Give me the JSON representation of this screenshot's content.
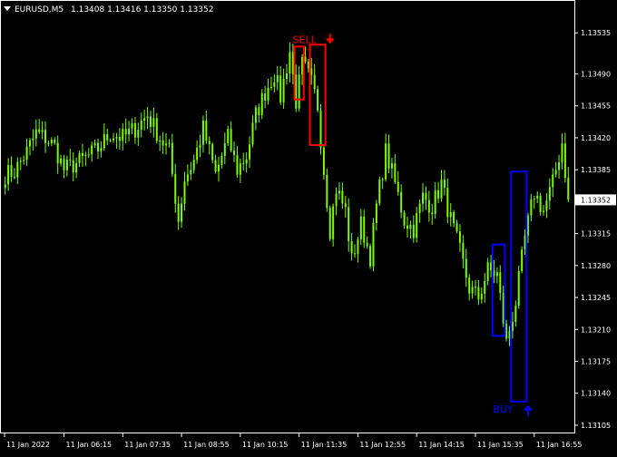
{
  "header": {
    "symbol": "EURUSD,M5",
    "ohlc": "1.13408 1.13416 1.13350 1.13352"
  },
  "colors": {
    "background": "#000000",
    "candle": "#7CFC00",
    "axis": "#ffffff",
    "sell": "#ff0000",
    "buy": "#0000ff",
    "price_tag_bg": "#ffffff",
    "price_tag_text": "#000000"
  },
  "signals": {
    "sell_label": "SELL",
    "buy_label": "BUY"
  },
  "chart_data": {
    "type": "candlestick",
    "title": "EURUSD,M5",
    "y_ticks": [
      "1.13535",
      "1.13490",
      "1.13455",
      "1.13420",
      "1.13385",
      "1.13350",
      "1.13315",
      "1.13280",
      "1.13245",
      "1.13210",
      "1.13175",
      "1.13140",
      "1.13105"
    ],
    "x_ticks": [
      "11 Jan 2022",
      "11 Jan 06:15",
      "11 Jan 07:35",
      "11 Jan 08:55",
      "11 Jan 10:15",
      "11 Jan 11:35",
      "11 Jan 12:55",
      "11 Jan 14:15",
      "11 Jan 15:35",
      "11 Jan 16:55"
    ],
    "ylim": [
      1.13097,
      1.1357
    ],
    "current_price": "1.13352",
    "close_path": [
      [
        0,
        1.1338
      ],
      [
        3,
        1.13383
      ],
      [
        7,
        1.13405
      ],
      [
        10,
        1.13425
      ],
      [
        13,
        1.1342
      ],
      [
        16,
        1.1341
      ],
      [
        19,
        1.13385
      ],
      [
        23,
        1.13392
      ],
      [
        27,
        1.134
      ],
      [
        30,
        1.13408
      ],
      [
        34,
        1.13425
      ],
      [
        38,
        1.1342
      ],
      [
        42,
        1.1343
      ],
      [
        46,
        1.13445
      ],
      [
        50,
        1.1342
      ],
      [
        53,
        1.13405
      ],
      [
        56,
        1.1333
      ],
      [
        58,
        1.13375
      ],
      [
        61,
        1.13395
      ],
      [
        64,
        1.1343
      ],
      [
        68,
        1.1338
      ],
      [
        72,
        1.1342
      ],
      [
        75,
        1.13385
      ],
      [
        78,
        1.134
      ],
      [
        81,
        1.13445
      ],
      [
        84,
        1.1347
      ],
      [
        87,
        1.1349
      ],
      [
        89,
        1.13465
      ],
      [
        92,
        1.13515
      ],
      [
        94,
        1.1346
      ],
      [
        96,
        1.135
      ],
      [
        97,
        1.13495
      ],
      [
        99,
        1.1348
      ],
      [
        101,
        1.13455
      ],
      [
        103,
        1.13385
      ],
      [
        105,
        1.1332
      ],
      [
        107,
        1.13365
      ],
      [
        110,
        1.1334
      ],
      [
        112,
        1.13285
      ],
      [
        115,
        1.13325
      ],
      [
        118,
        1.1329
      ],
      [
        120,
        1.13345
      ],
      [
        123,
        1.13405
      ],
      [
        126,
        1.1337
      ],
      [
        129,
        1.1333
      ],
      [
        132,
        1.1332
      ],
      [
        135,
        1.13355
      ],
      [
        138,
        1.13345
      ],
      [
        141,
        1.1337
      ],
      [
        144,
        1.1333
      ],
      [
        147,
        1.13295
      ],
      [
        150,
        1.13255
      ],
      [
        153,
        1.13245
      ],
      [
        156,
        1.13275
      ],
      [
        159,
        1.1327
      ],
      [
        162,
        1.13195
      ],
      [
        165,
        1.1324
      ],
      [
        168,
        1.1331
      ],
      [
        171,
        1.1336
      ],
      [
        174,
        1.1334
      ],
      [
        177,
        1.1337
      ],
      [
        180,
        1.13415
      ],
      [
        182,
        1.13352
      ]
    ],
    "last_index": 182,
    "signals": [
      {
        "type": "sell",
        "label": "SELL",
        "box_start": 94,
        "box_end": 96,
        "box_high": 1.1352,
        "box_low": 1.13462,
        "arrow_index": 105
      },
      {
        "type": "sell",
        "label": "",
        "box_start": 99,
        "box_end": 103,
        "box_high": 1.13522,
        "box_low": 1.13412,
        "arrow_index": null
      },
      {
        "type": "buy",
        "label": "",
        "box_start": 158,
        "box_end": 161,
        "box_high": 1.13303,
        "box_low": 1.13203,
        "arrow_index": null
      },
      {
        "type": "buy",
        "label": "BUY",
        "box_start": 164,
        "box_end": 168,
        "box_high": 1.13383,
        "box_low": 1.13131,
        "arrow_index": 169
      }
    ]
  }
}
